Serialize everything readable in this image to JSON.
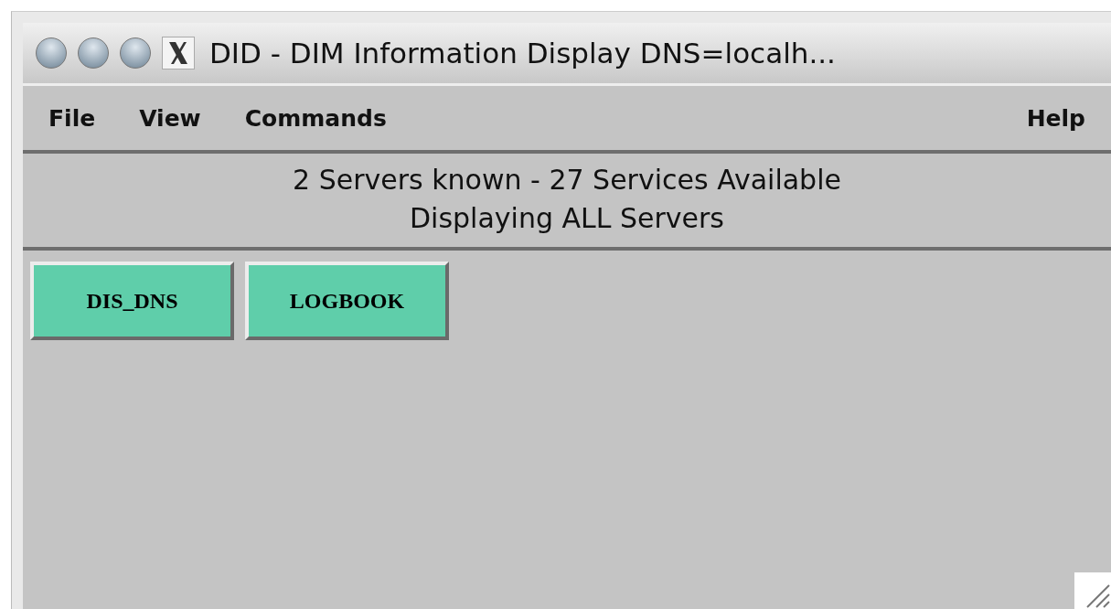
{
  "window": {
    "title": "DID - DIM Information Display DNS=localh..."
  },
  "menu": [
    "File",
    "View",
    "Commands"
  ],
  "help_menu": "Help",
  "status": [
    "2 Servers known - 27 Services Available",
    "Displaying ALL Servers"
  ],
  "servers": [
    "DIS_DNS",
    "LOGBOOK"
  ]
}
